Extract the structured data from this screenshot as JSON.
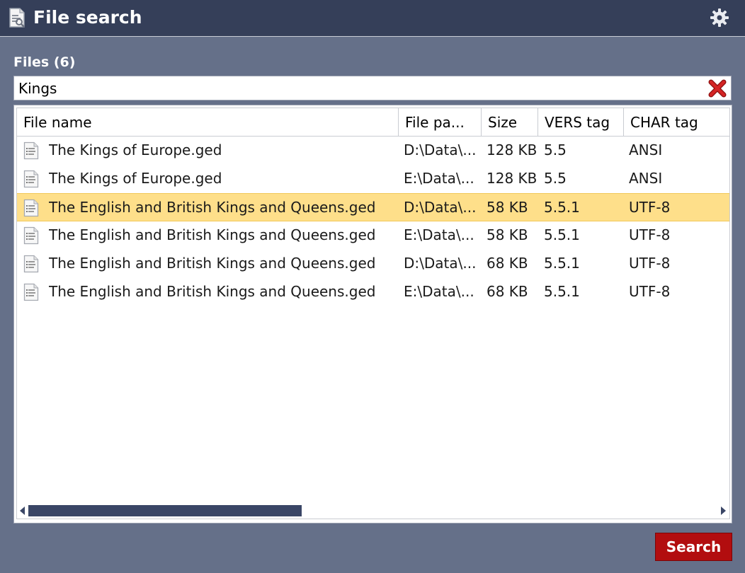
{
  "window": {
    "title": "File search"
  },
  "files_label": "Files (6)",
  "search": {
    "value": "Kings"
  },
  "table": {
    "columns": [
      "File name",
      "File pa...",
      "Size",
      "VERS tag",
      "CHAR tag"
    ],
    "rows": [
      {
        "name": "The Kings of Europe.ged",
        "path": "D:\\Data\\...",
        "size": "128 KB",
        "vers": "5.5",
        "char": "ANSI"
      },
      {
        "name": "The Kings of Europe.ged",
        "path": "E:\\Data\\...",
        "size": "128 KB",
        "vers": "5.5",
        "char": "ANSI"
      },
      {
        "name": "The English and British Kings and Queens.ged",
        "path": "D:\\Data\\...",
        "size": "58 KB",
        "vers": "5.5.1",
        "char": "UTF-8"
      },
      {
        "name": "The English and British Kings and Queens.ged",
        "path": "E:\\Data\\...",
        "size": "58 KB",
        "vers": "5.5.1",
        "char": "UTF-8"
      },
      {
        "name": "The English and British Kings and Queens.ged",
        "path": "D:\\Data\\...",
        "size": "68 KB",
        "vers": "5.5.1",
        "char": "UTF-8"
      },
      {
        "name": "The English and British Kings and Queens.ged",
        "path": "E:\\Data\\...",
        "size": "68 KB",
        "vers": "5.5.1",
        "char": "UTF-8"
      }
    ],
    "selected_index": 2
  },
  "search_button": {
    "label": "Search"
  },
  "colors": {
    "titlebar": "#353f59",
    "background": "#657089",
    "selection": "#fedf8a",
    "search_button": "#b20d0f",
    "scrollbar": "#3a4666"
  },
  "icons": {
    "app": "document-search-icon",
    "settings": "gear-icon",
    "clear": "clear-x-icon",
    "file": "gedcom-file-icon"
  }
}
